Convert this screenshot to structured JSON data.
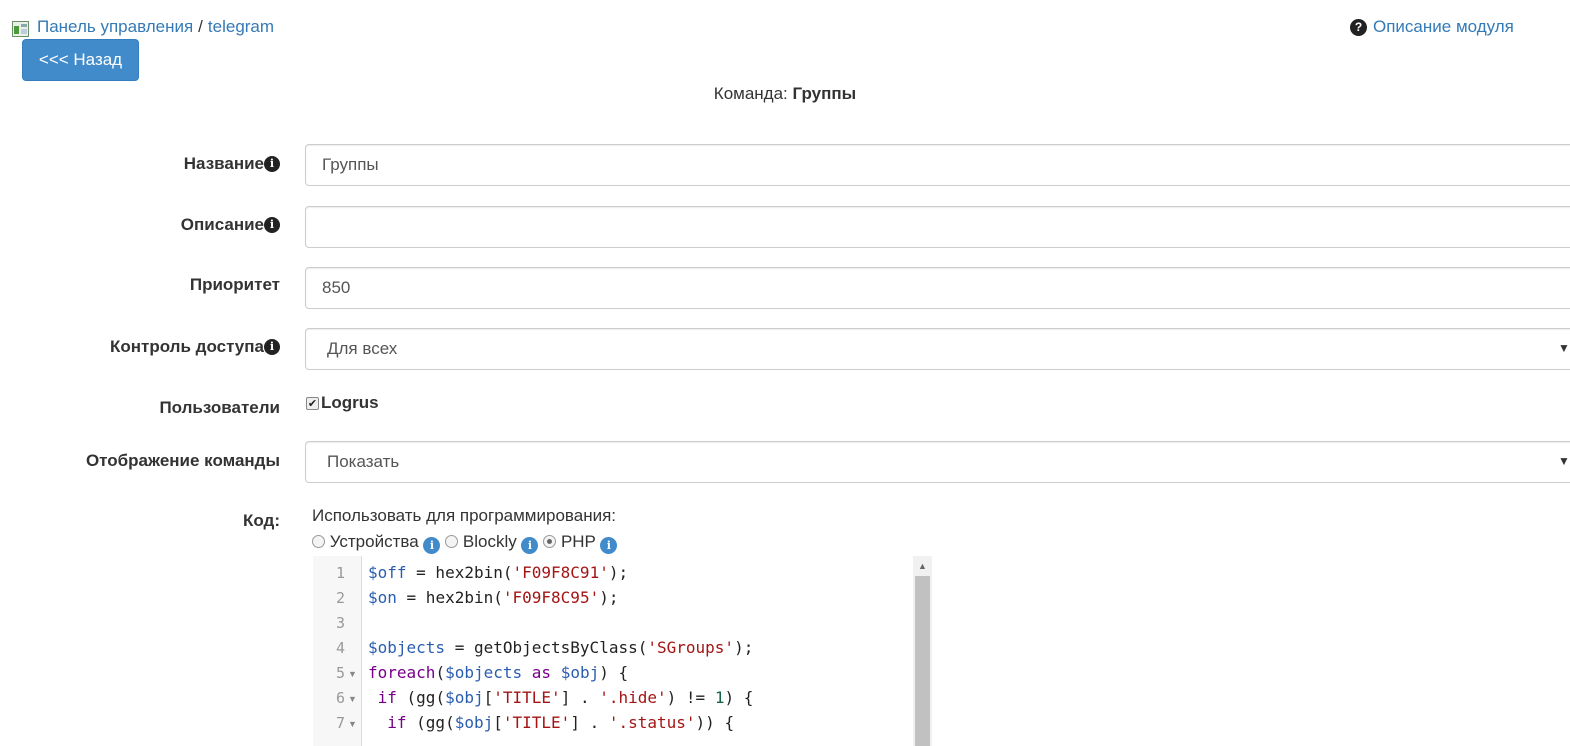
{
  "breadcrumb": {
    "home": "Панель управления",
    "separator": "/",
    "current": "telegram"
  },
  "module_link": "Описание модуля",
  "back_button": "<<< Назад",
  "command": {
    "prefix": "Команда:",
    "name": "Группы"
  },
  "form": {
    "name_label": "Название",
    "name_value": "Группы",
    "description_label": "Описание",
    "description_value": "",
    "priority_label": "Приоритет",
    "priority_value": "850",
    "access_label": "Контроль доступа",
    "access_value": "Для всех",
    "users_label": "Пользователи",
    "users": [
      {
        "name": "Logrus",
        "checked": true
      }
    ],
    "display_label": "Отображение команды",
    "display_value": "Показать",
    "code_label": "Код:",
    "use_for_programming": "Использовать для программирования:",
    "modes": [
      {
        "label": "Устройства",
        "selected": false
      },
      {
        "label": "Blockly",
        "selected": false
      },
      {
        "label": "PHP",
        "selected": true
      }
    ]
  },
  "code_lines": [
    "$off = hex2bin('F09F8C91');",
    "$on = hex2bin('F09F8C95');",
    "",
    "$objects = getObjectsByClass('SGroups');",
    "foreach($objects as $obj) {",
    " if (gg($obj['TITLE'] . '.hide') != 1) {",
    "  if (gg($obj['TITLE'] . '.status')) {"
  ],
  "line_numbers": [
    "1",
    "2",
    "3",
    "4",
    "5",
    "6",
    "7"
  ],
  "colors": {
    "link": "#337ab7",
    "button": "#428bca"
  }
}
